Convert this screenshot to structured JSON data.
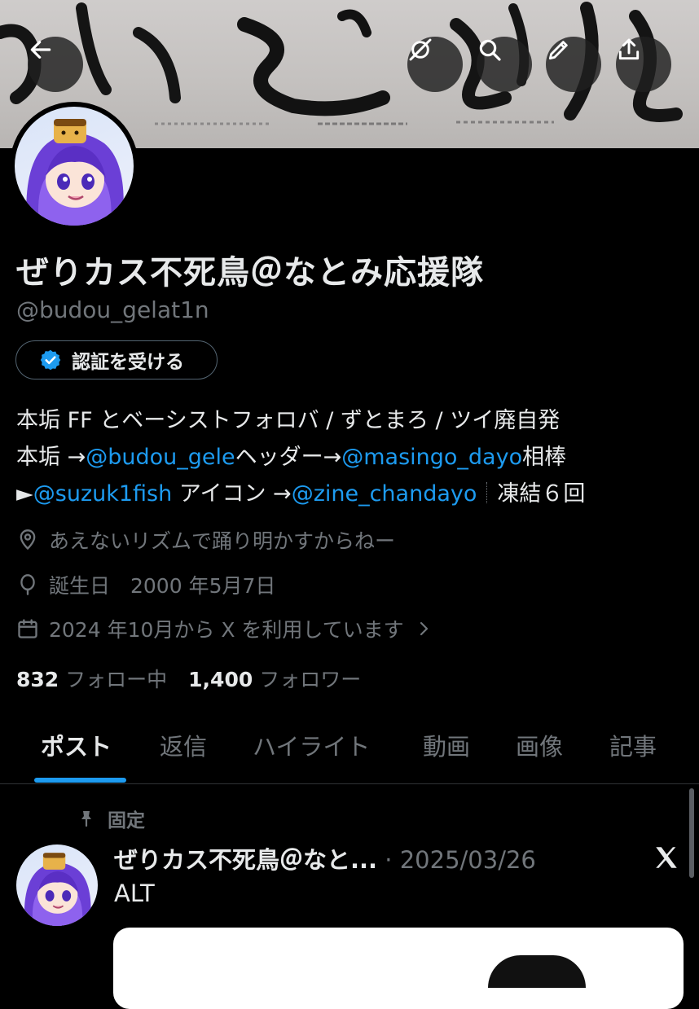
{
  "header": {
    "back_icon": "arrow-left-icon",
    "grok_icon": "slash-circle-icon",
    "search_icon": "search-icon",
    "edit_icon": "pencil-icon",
    "share_icon": "share-icon"
  },
  "profile": {
    "display_name": "ぜりカス不死鳥＠なとみ応援隊",
    "handle": "@budou_gelat1n",
    "verify_label": "認証を受ける",
    "bio": {
      "line1": "本垢 FF とベーシストフォロバ / ずとまろ / ツイ廃自発",
      "line2_prefix": "本垢 →",
      "line2_link1": "@budou_gele",
      "line2_mid": "ヘッダー→",
      "line2_link2": "@masingo_dayo",
      "line2_suffix": "相棒",
      "line3_prefix": "►",
      "line3_link1": "@suzuk1fish",
      "line3_mid": " アイコン →",
      "line3_link2": "@zine_chandayo",
      "line3_suffix": "凍結６回"
    },
    "location": "あえないリズムで踊り明かすからねー",
    "birthday": "誕生日　2000 年5月7日",
    "joined": "2024 年10月から X を利用しています"
  },
  "stats": {
    "following_count": "832",
    "following_label": "フォロー中",
    "followers_count": "1,400",
    "followers_label": "フォロワー"
  },
  "tabs": [
    "ポスト",
    "返信",
    "ハイライト",
    "動画",
    "画像",
    "記事"
  ],
  "pinned_post": {
    "pinned_label": "固定",
    "author": "ぜりカス不死鳥＠なと...",
    "date": "· 2025/03/26",
    "text": "ALT"
  },
  "colors": {
    "accent": "#1d9bf0",
    "muted": "#71767b",
    "text": "#e7e9ea",
    "background": "#000000"
  }
}
